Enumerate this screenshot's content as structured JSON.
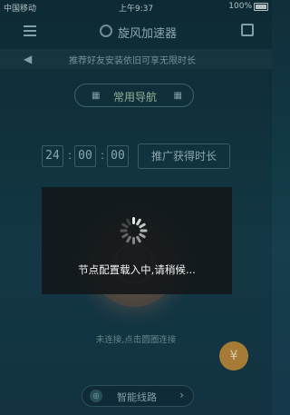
{
  "status_bar": {
    "carrier": "中国移动",
    "time": "上午9:37",
    "battery": "100%"
  },
  "header": {
    "title": "旋风加速器"
  },
  "notice": {
    "text": "推荐好友安装依旧可享无限时长"
  },
  "mode_button": {
    "label": "常用导航"
  },
  "timer": {
    "hours": "24",
    "minutes": "00",
    "seconds": "00",
    "separator": ":"
  },
  "promo_button": {
    "label": "推广获得时长"
  },
  "main": {
    "hint": "未连接,点击圆圈连接"
  },
  "fab": {
    "symbol": "¥"
  },
  "line_selector": {
    "label": "智能线路",
    "chevron": "›"
  },
  "loading": {
    "message": "节点配置载入中,请稍候..."
  },
  "icons": {
    "menu": "hamburger-icon",
    "logo": "app-logo-icon",
    "share": "share-icon",
    "speaker": "speaker-icon",
    "grid": "grid-icon",
    "power": "power-icon",
    "line": "route-icon",
    "spinner": "spinner-icon"
  },
  "colors": {
    "background": "#123845",
    "accent_green": "#a3c2a6",
    "fab_gold": "#b98a3c",
    "modal": "#14181a"
  }
}
